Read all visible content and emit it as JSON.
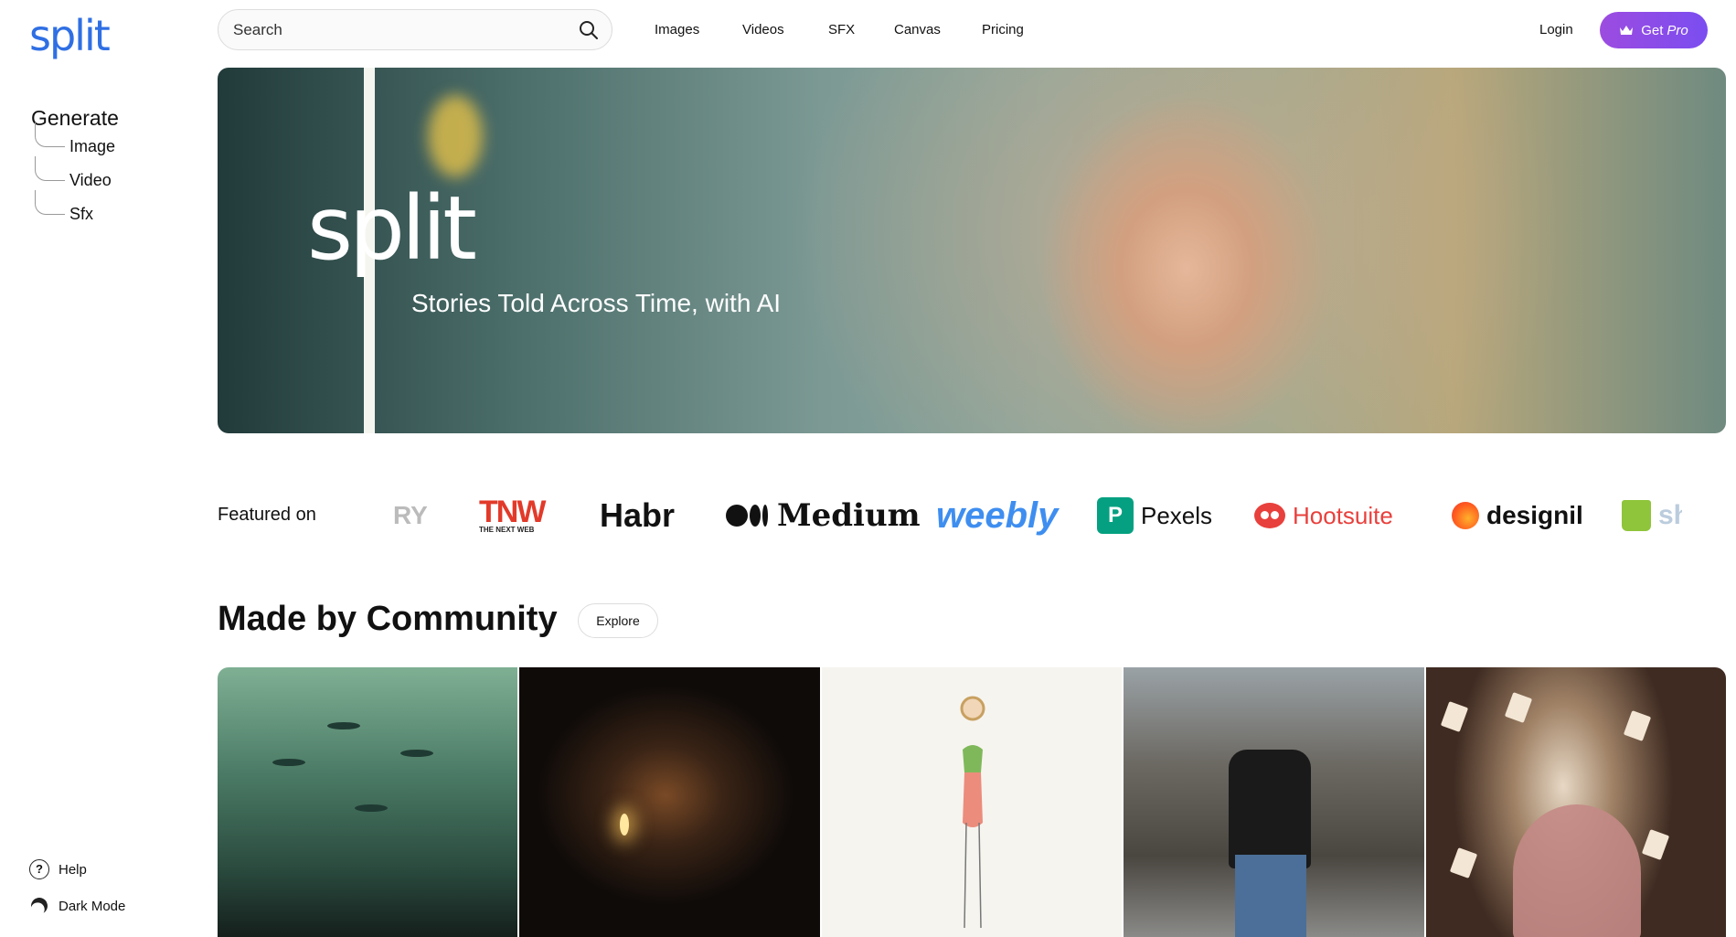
{
  "app": {
    "logo": "split"
  },
  "sidebar": {
    "generate_title": "Generate",
    "items": [
      {
        "label": "Image"
      },
      {
        "label": "Video"
      },
      {
        "label": "Sfx"
      }
    ],
    "help_label": "Help",
    "dark_mode_label": "Dark Mode",
    "help_icon_glyph": "?"
  },
  "topbar": {
    "search_placeholder": "Search",
    "nav": [
      {
        "label": "Images"
      },
      {
        "label": "Videos"
      },
      {
        "label": "SFX"
      },
      {
        "label": "Canvas"
      },
      {
        "label": "Pricing"
      }
    ],
    "login_label": "Login",
    "pro_label_prefix": "Get",
    "pro_label_emph": "Pro",
    "accent_color": "#8b4ee8"
  },
  "hero": {
    "logo": "split",
    "tagline": "Stories Told Across Time, with AI"
  },
  "featured": {
    "label": "Featured on",
    "brands": {
      "partial_left": "RY",
      "tnw_big": "TNW",
      "tnw_small": "THE NEXT WEB",
      "habr": "Habr",
      "medium": "Medium",
      "weebly": "weebly",
      "pexels_mark": "P",
      "pexels": "Pexels",
      "hootsuite": "Hootsuite",
      "designil": "designil",
      "partial_right": "sh"
    }
  },
  "community": {
    "title": "Made by Community",
    "explore_label": "Explore"
  }
}
